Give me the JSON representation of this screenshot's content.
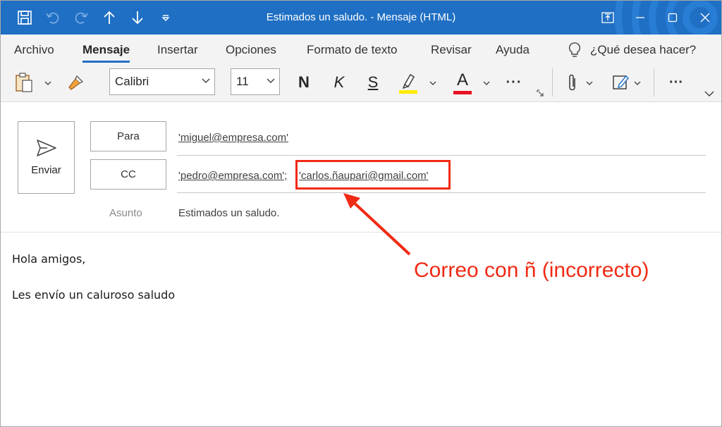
{
  "window": {
    "title": "Estimados un saludo.  -  Mensaje (HTML)"
  },
  "tabs": [
    "Archivo",
    "Mensaje",
    "Insertar",
    "Opciones",
    "Formato de texto",
    "Revisar",
    "Ayuda"
  ],
  "active_tab": "Mensaje",
  "tell_me": "¿Qué desea hacer?",
  "toolbar": {
    "font_name": "Calibri",
    "font_size": "11",
    "bold": "N",
    "italic": "K",
    "strike": "S",
    "font_color_glyph": "A",
    "more": "···",
    "overflow": "···"
  },
  "colors": {
    "accent": "#1f6fc4",
    "highlight_yellow": "#ffeb00",
    "font_red": "#e81123",
    "annotation_red": "#f02a14"
  },
  "header": {
    "send_label": "Enviar",
    "to_label": "Para",
    "cc_label": "CC",
    "subject_label": "Asunto",
    "to_value": "'miguel@empresa.com'",
    "cc_value_1": "'pedro@empresa.com';",
    "cc_value_2": "'carlos.ñaupari@gmail.com'",
    "subject_value": "Estimados un saludo."
  },
  "body": {
    "line1": "Hola amigos,",
    "line2": "Les envío un caluroso saludo"
  },
  "annotation": {
    "text": "Correo con ñ (incorrecto)"
  }
}
